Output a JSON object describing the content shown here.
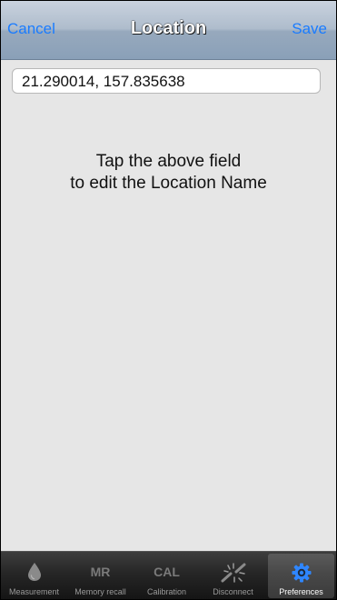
{
  "navbar": {
    "cancel_label": "Cancel",
    "title": "Location",
    "save_label": "Save"
  },
  "location_field": {
    "value": "21.290014, 157.835638"
  },
  "hint": {
    "line1": "Tap the above field",
    "line2": "to edit the Location Name"
  },
  "tabbar": {
    "selected": "Preferences",
    "tabs": [
      {
        "label": "Measurement",
        "icon": "water-drop-icon"
      },
      {
        "label": "Memory recall",
        "icon_text": "MR"
      },
      {
        "label": "Calibration",
        "icon_text": "CAL"
      },
      {
        "label": "Disconnect",
        "icon": "disconnect-icon"
      },
      {
        "label": "Preferences",
        "icon": "gear-icon"
      }
    ]
  },
  "colors": {
    "accent": "#1a7cff",
    "background": "#e6e6e6",
    "selected_icon": "#2f86ff"
  }
}
